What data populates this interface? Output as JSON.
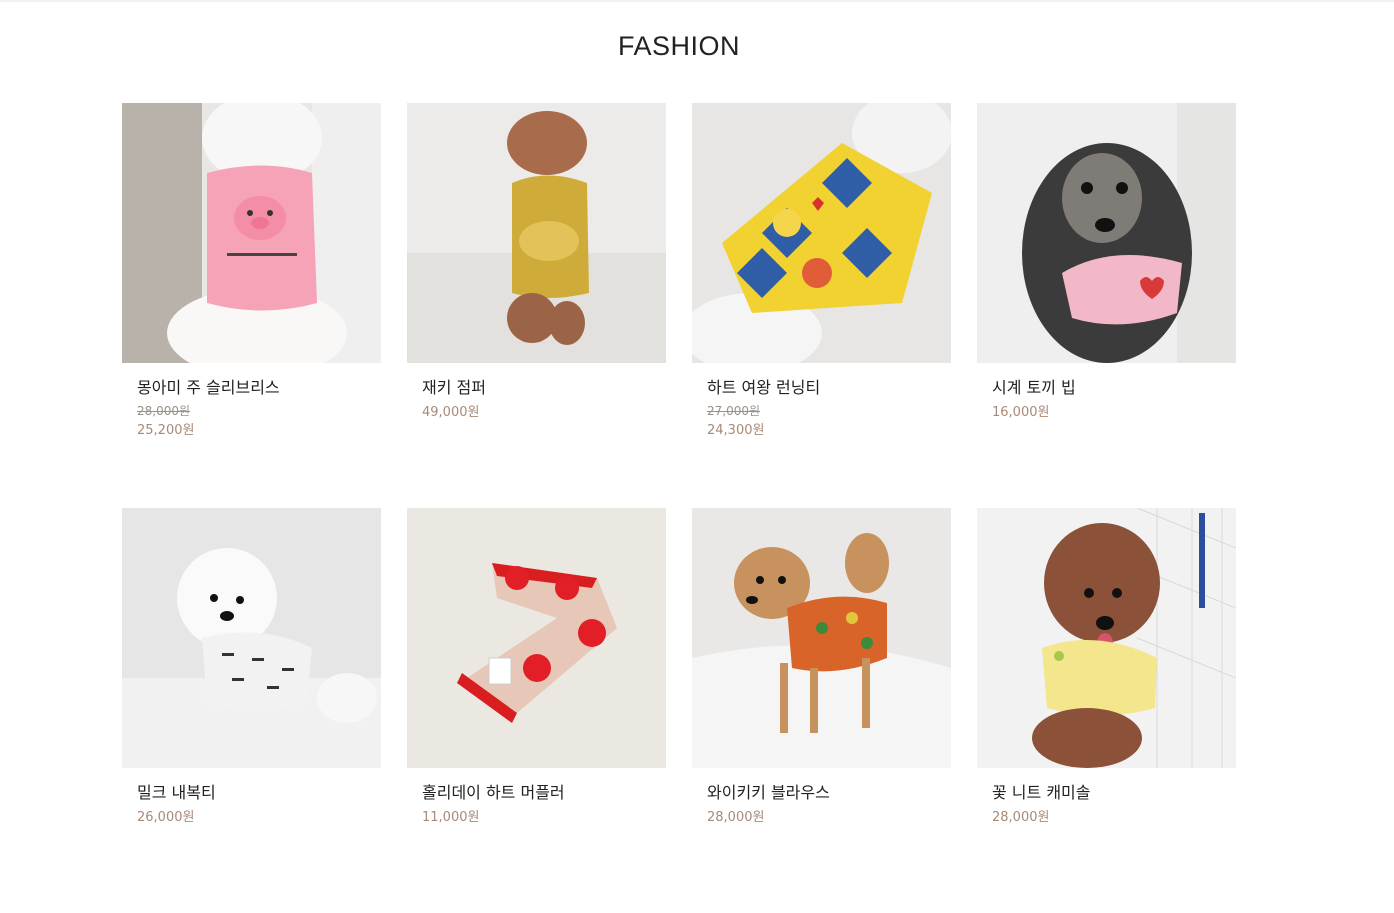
{
  "section": {
    "title": "FASHION"
  },
  "products": [
    {
      "name": "몽아미 주 슬리브리스",
      "original_price": "28,000원",
      "price": "25,200원",
      "image_icon": "pink-pig-sleeveless-dog-photo"
    },
    {
      "name": "재키 점퍼",
      "original_price": "",
      "price": "49,000원",
      "image_icon": "yellow-jumper-poodle-photo"
    },
    {
      "name": "하트 여왕 런닝티",
      "original_price": "27,000원",
      "price": "24,300원",
      "image_icon": "heart-queen-running-tee-photo"
    },
    {
      "name": "시계 토끼 빕",
      "original_price": "",
      "price": "16,000원",
      "image_icon": "rabbit-bib-terrier-photo"
    },
    {
      "name": "밀크 내복티",
      "original_price": "",
      "price": "26,000원",
      "image_icon": "milk-tee-bichon-photo"
    },
    {
      "name": "홀리데이 하트 머플러",
      "original_price": "",
      "price": "11,000원",
      "image_icon": "heart-muffler-photo"
    },
    {
      "name": "와이키키 블라우스",
      "original_price": "",
      "price": "28,000원",
      "image_icon": "waikiki-blouse-pomeranian-photo"
    },
    {
      "name": "꽃 니트 캐미솔",
      "original_price": "",
      "price": "28,000원",
      "image_icon": "flower-knit-camisole-poodle-photo"
    }
  ],
  "colors": {
    "price": "#a88a78",
    "strike_price": "#999189"
  }
}
